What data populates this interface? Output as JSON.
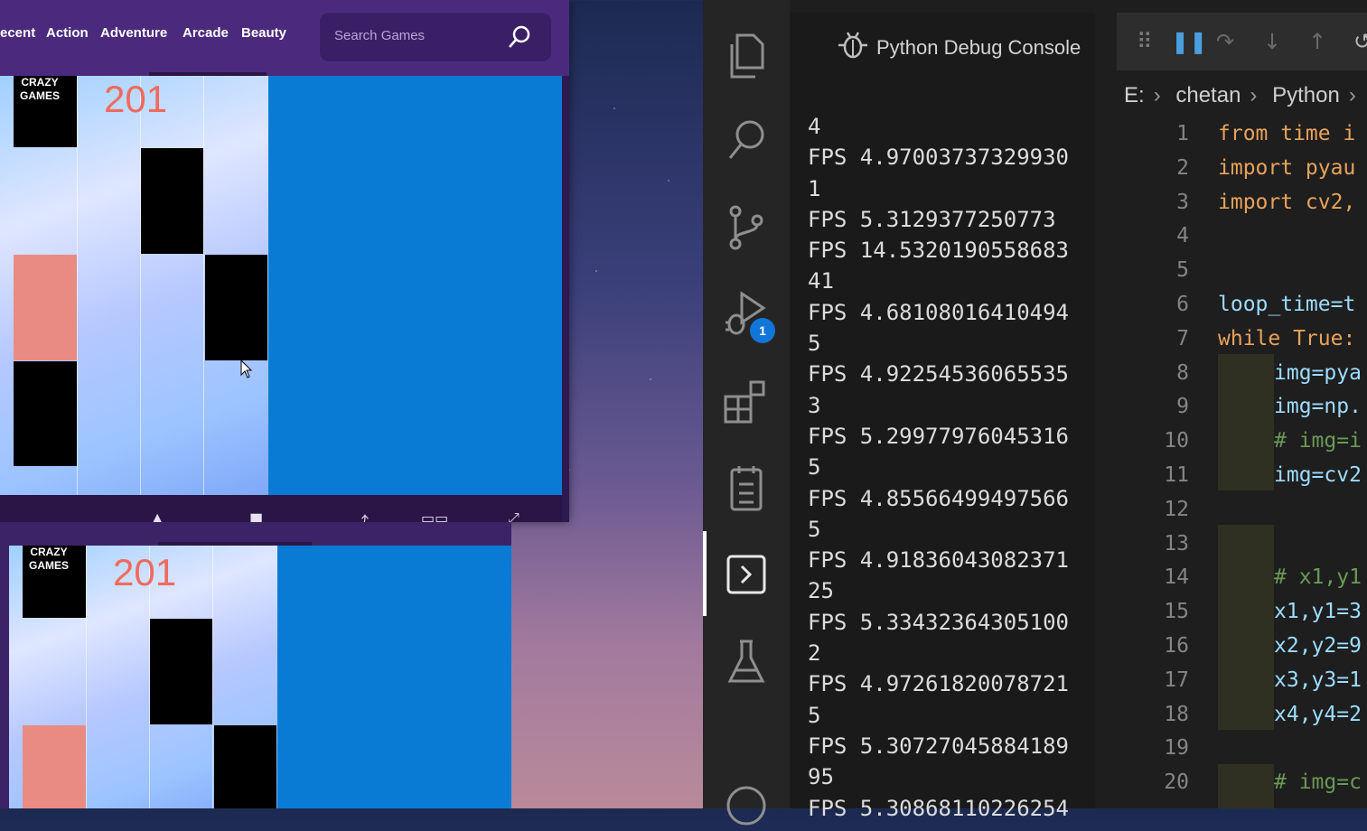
{
  "browser": {
    "nav_links": [
      "ecent",
      "Action",
      "Adventure",
      "Arcade",
      "Beauty"
    ],
    "search_placeholder": "Search Games",
    "logo_line1": "CRAZY",
    "logo_line2": "GAMES",
    "score_top": "201",
    "score_bottom": "201"
  },
  "vscode": {
    "panel_title": "Python Debug Console",
    "debug_badge": "1",
    "breadcrumbs": [
      "E:",
      "chetan",
      "Python"
    ],
    "console_lines": [
      "4",
      "FPS 4.97003737329930",
      "1",
      "FPS 5.3129377250773",
      "FPS 14.5320190558683",
      "41",
      "FPS 4.68108016410494",
      "5",
      "FPS 4.92254536065535",
      "3",
      "FPS 5.29977976045316",
      "5",
      "FPS 4.85566499497566",
      "5",
      "FPS 4.91836043082371",
      "25",
      "FPS 5.33432364305100",
      "2",
      "FPS 4.97261820078721",
      "5",
      "FPS 5.30727045884189",
      "95",
      "FPS 5.30868110226254"
    ],
    "line_numbers": [
      "1",
      "2",
      "3",
      "4",
      "5",
      "6",
      "7",
      "8",
      "9",
      "10",
      "11",
      "12",
      "13",
      "14",
      "15",
      "16",
      "17",
      "18",
      "19",
      "20"
    ],
    "code_lines": [
      {
        "t": "from time i",
        "c": "kw",
        "i": 0
      },
      {
        "t": "import pyau",
        "c": "kw",
        "i": 0
      },
      {
        "t": "import cv2,",
        "c": "kw",
        "i": 0
      },
      {
        "t": "",
        "c": "",
        "i": 0
      },
      {
        "t": "",
        "c": "",
        "i": 0
      },
      {
        "t": "loop_time=t",
        "c": "vr",
        "i": 0
      },
      {
        "t": "while True:",
        "c": "kw",
        "i": 0
      },
      {
        "t": "img=pya",
        "c": "vr",
        "i": 1
      },
      {
        "t": "img=np.",
        "c": "vr",
        "i": 1
      },
      {
        "t": "# img=i",
        "c": "cm",
        "i": 1
      },
      {
        "t": "img=cv2",
        "c": "vr",
        "i": 1
      },
      {
        "t": "",
        "c": "",
        "i": 0
      },
      {
        "t": "",
        "c": "",
        "i": 0
      },
      {
        "t": "# x1,y1",
        "c": "cm",
        "i": 1
      },
      {
        "t": "x1,y1=3",
        "c": "vr",
        "i": 1
      },
      {
        "t": "x2,y2=9",
        "c": "vr",
        "i": 1
      },
      {
        "t": "x3,y3=1",
        "c": "vr",
        "i": 1
      },
      {
        "t": "x4,y4=2",
        "c": "vr",
        "i": 1
      },
      {
        "t": "",
        "c": "",
        "i": 0
      },
      {
        "t": "# img=c",
        "c": "cm",
        "i": 1
      }
    ]
  }
}
